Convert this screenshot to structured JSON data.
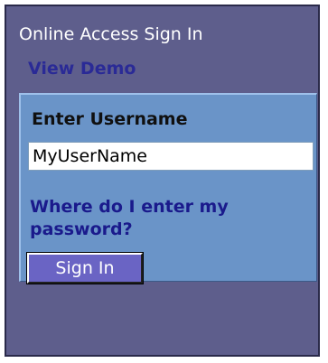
{
  "header": {
    "title": "Online Access Sign In",
    "demo_link": "View Demo"
  },
  "form": {
    "username_label": "Enter Username",
    "username_value": "MyUserName",
    "password_help_link": "Where do I enter my password?",
    "signin_button": "Sign In"
  }
}
